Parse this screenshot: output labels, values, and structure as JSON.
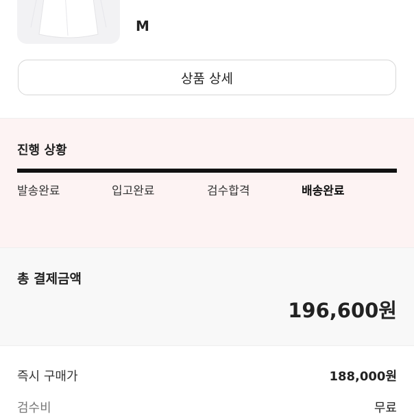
{
  "product": {
    "size": "M",
    "detail_button": "상품 상세"
  },
  "progress": {
    "title": "진행 상황",
    "completion": 1.0,
    "steps": [
      {
        "label": "발송완료",
        "active": false
      },
      {
        "label": "입고완료",
        "active": false
      },
      {
        "label": "검수합격",
        "active": false
      },
      {
        "label": "배송완료",
        "active": true
      }
    ]
  },
  "payment": {
    "total_label": "총 결제금액",
    "total_amount": "196,600원",
    "rows": [
      {
        "label": "즉시 구매가",
        "value": "188,000원"
      },
      {
        "label": "검수비",
        "value": "무료"
      }
    ]
  },
  "colors": {
    "progress_bg": "#fdf3f3",
    "progress_bar": "#111111",
    "payment_bg": "#f8f8f8"
  }
}
